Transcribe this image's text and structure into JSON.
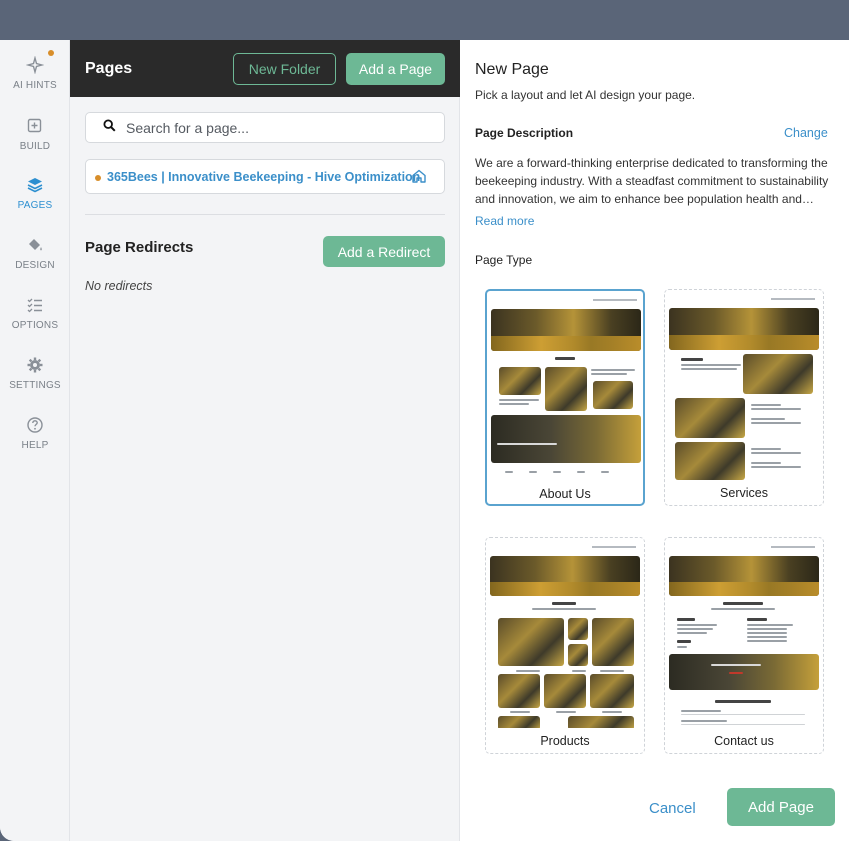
{
  "rail": {
    "items": [
      {
        "label": "AI HINTS",
        "icon": "sparkle-icon"
      },
      {
        "label": "BUILD",
        "icon": "build-icon"
      },
      {
        "label": "PAGES",
        "icon": "layers-icon"
      },
      {
        "label": "DESIGN",
        "icon": "paint-bucket-icon"
      },
      {
        "label": "OPTIONS",
        "icon": "checklist-icon"
      },
      {
        "label": "SETTINGS",
        "icon": "gear-icon"
      },
      {
        "label": "HELP",
        "icon": "help-icon"
      }
    ],
    "active": "PAGES"
  },
  "pages_panel": {
    "title": "Pages",
    "new_folder_label": "New Folder",
    "add_page_label": "Add a Page",
    "search_placeholder": "Search for a page...",
    "pages": [
      {
        "name": "365Bees | Innovative Beekeeping - Hive Optimization"
      }
    ],
    "redirects_title": "Page Redirects",
    "add_redirect_label": "Add a Redirect",
    "no_redirects": "No redirects"
  },
  "new_page": {
    "title": "New Page",
    "subtitle": "Pick a layout and let AI design your page.",
    "description_label": "Page Description",
    "change_label": "Change",
    "description": "We are a forward-thinking enterprise dedicated to transforming the beekeeping industry. With a steadfast commitment to sustainability and innovation, we aim to enhance bee population health and…",
    "read_more": "Read more",
    "page_type_label": "Page Type",
    "page_types": [
      {
        "label": "About Us",
        "selected": true
      },
      {
        "label": "Services",
        "selected": false
      },
      {
        "label": "Products",
        "selected": false
      },
      {
        "label": "Contact us",
        "selected": false
      }
    ],
    "cancel_label": "Cancel",
    "add_page_label": "Add Page"
  },
  "colors": {
    "accent_green": "#6db895",
    "link_blue": "#3b8fc9",
    "dot_orange": "#d88e2a",
    "topbar": "#5a6578"
  }
}
